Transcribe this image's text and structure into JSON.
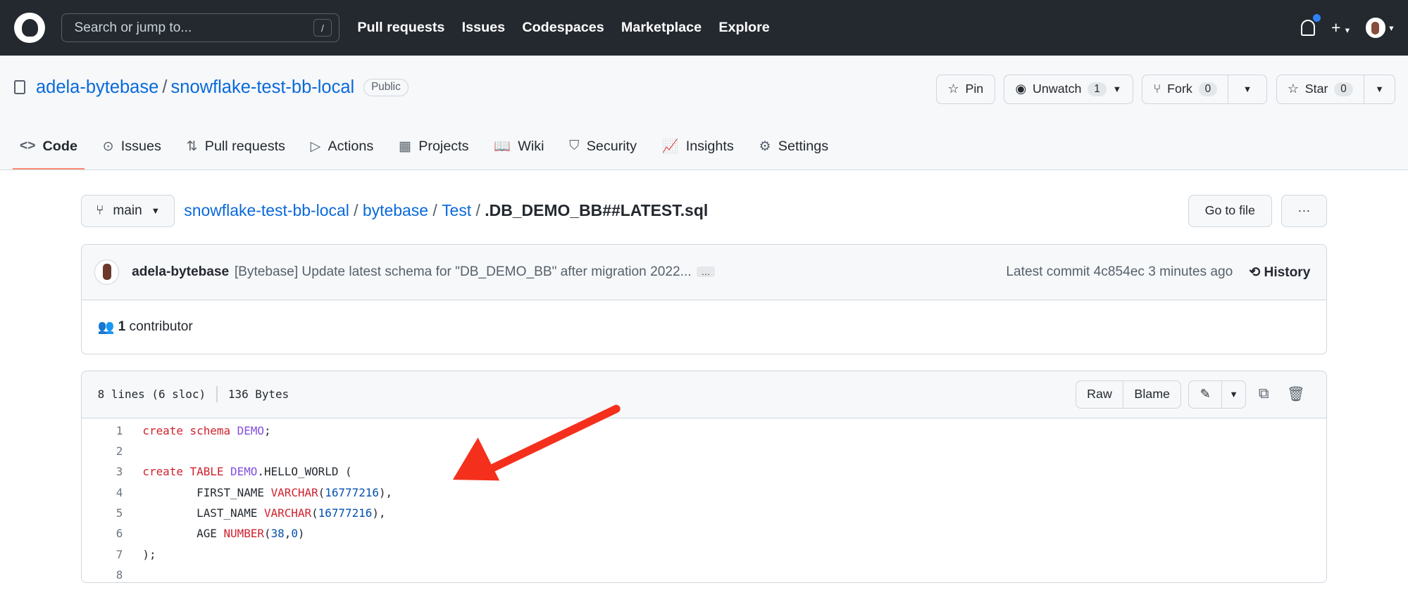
{
  "topnav": {
    "search_placeholder": "Search or jump to...",
    "search_shortcut": "/",
    "links": [
      "Pull requests",
      "Issues",
      "Codespaces",
      "Marketplace",
      "Explore"
    ],
    "plus": "+"
  },
  "repo": {
    "owner": "adela-bytebase",
    "separator": "/",
    "name": "snowflake-test-bb-local",
    "visibility": "Public",
    "pin": "Pin",
    "unwatch": "Unwatch",
    "watch_count": "1",
    "fork": "Fork",
    "fork_count": "0",
    "star": "Star",
    "star_count": "0"
  },
  "tabs": [
    {
      "label": "Code",
      "icon": "<>"
    },
    {
      "label": "Issues",
      "icon": "⊙"
    },
    {
      "label": "Pull requests",
      "icon": "⇅"
    },
    {
      "label": "Actions",
      "icon": "▷"
    },
    {
      "label": "Projects",
      "icon": "▦"
    },
    {
      "label": "Wiki",
      "icon": "📖"
    },
    {
      "label": "Security",
      "icon": "⛉"
    },
    {
      "label": "Insights",
      "icon": "📈"
    },
    {
      "label": "Settings",
      "icon": "⚙"
    }
  ],
  "breadcrumb": {
    "branch": "main",
    "parts": [
      "snowflake-test-bb-local",
      "bytebase",
      "Test"
    ],
    "file": ".DB_DEMO_BB##LATEST.sql",
    "goto": "Go to file",
    "more": "···"
  },
  "commit": {
    "author": "adela-bytebase",
    "message": "[Bytebase] Update latest schema for \"DB_DEMO_BB\" after migration 2022...",
    "ellipsis": "…",
    "latest": "Latest commit 4c854ec 3 minutes ago",
    "history": "History",
    "contributors_count": "1",
    "contributors_label": "contributor"
  },
  "file": {
    "lines": "8 lines (6 sloc)",
    "size": "136 Bytes",
    "raw": "Raw",
    "blame": "Blame"
  },
  "code": [
    [
      {
        "t": "create schema ",
        "c": "k"
      },
      {
        "t": "DEMO",
        "c": "e"
      },
      {
        "t": ";",
        "c": ""
      }
    ],
    [],
    [
      {
        "t": "create TABLE ",
        "c": "k"
      },
      {
        "t": "DEMO",
        "c": "e"
      },
      {
        "t": ".HELLO_WORLD (",
        "c": ""
      }
    ],
    [
      {
        "t": "        FIRST_NAME ",
        "c": ""
      },
      {
        "t": "VARCHAR",
        "c": "k"
      },
      {
        "t": "(",
        "c": ""
      },
      {
        "t": "16777216",
        "c": "n"
      },
      {
        "t": "),",
        "c": ""
      }
    ],
    [
      {
        "t": "        LAST_NAME ",
        "c": ""
      },
      {
        "t": "VARCHAR",
        "c": "k"
      },
      {
        "t": "(",
        "c": ""
      },
      {
        "t": "16777216",
        "c": "n"
      },
      {
        "t": "),",
        "c": ""
      }
    ],
    [
      {
        "t": "        AGE ",
        "c": ""
      },
      {
        "t": "NUMBER",
        "c": "k"
      },
      {
        "t": "(",
        "c": ""
      },
      {
        "t": "38",
        "c": "n"
      },
      {
        "t": ",",
        "c": ""
      },
      {
        "t": "0",
        "c": "n"
      },
      {
        "t": ")",
        "c": ""
      }
    ],
    [
      {
        "t": ");",
        "c": ""
      }
    ],
    []
  ],
  "colors": {
    "accent": "#0969da",
    "annotation_arrow": "#f4301c"
  }
}
